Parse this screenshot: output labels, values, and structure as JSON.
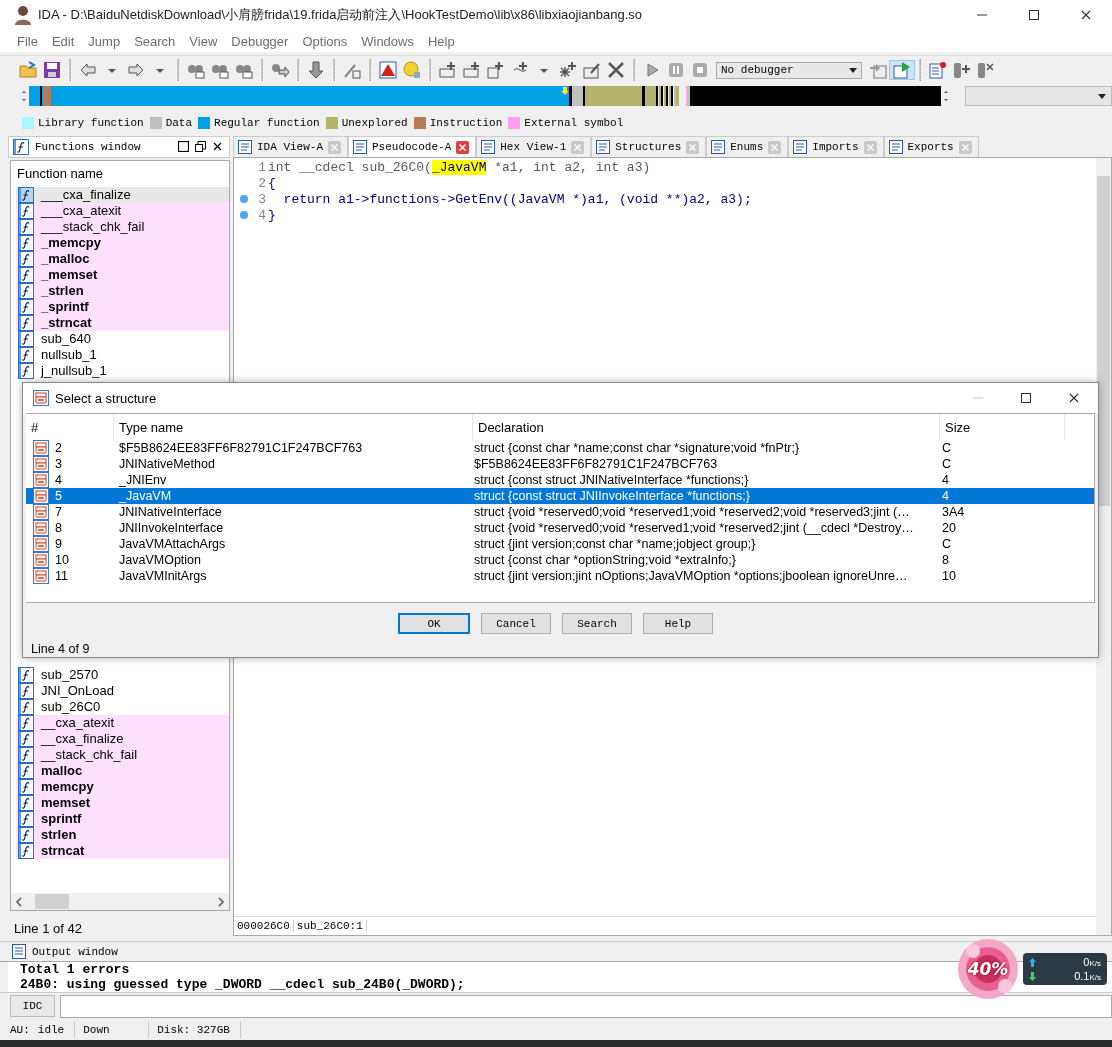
{
  "window": {
    "title": "IDA - D:\\BaiduNetdiskDownload\\小肩膀frida\\19.frida启动前注入\\HookTestDemo\\lib\\x86\\libxiaojianbang.so"
  },
  "menu": [
    "File",
    "Edit",
    "Jump",
    "Search",
    "View",
    "Debugger",
    "Options",
    "Windows",
    "Help"
  ],
  "debugger_select": {
    "value": "No debugger"
  },
  "legend": [
    {
      "label": "Library function",
      "color": "#aaf8ff"
    },
    {
      "label": "Data",
      "color": "#c0c0c0"
    },
    {
      "label": "Regular function",
      "color": "#00a0e6"
    },
    {
      "label": "Unexplored",
      "color": "#b4b46c"
    },
    {
      "label": "Instruction",
      "color": "#b87a58"
    },
    {
      "label": "External symbol",
      "color": "#ff9ff0"
    }
  ],
  "functions_window": {
    "title": "Functions window",
    "column": "Function name",
    "row_groups": [
      [
        {
          "name": "___cxa_finalize",
          "kind": "regular",
          "bold": false,
          "selected": true
        },
        {
          "name": "___cxa_atexit",
          "kind": "external",
          "bold": false,
          "selected": false
        },
        {
          "name": "___stack_chk_fail",
          "kind": "external",
          "bold": false,
          "selected": false
        },
        {
          "name": "_memcpy",
          "kind": "external",
          "bold": true,
          "selected": false
        },
        {
          "name": "_malloc",
          "kind": "external",
          "bold": true,
          "selected": false
        },
        {
          "name": "_memset",
          "kind": "external",
          "bold": true,
          "selected": false
        },
        {
          "name": "_strlen",
          "kind": "external",
          "bold": true,
          "selected": false
        },
        {
          "name": "_sprintf",
          "kind": "external",
          "bold": true,
          "selected": false
        },
        {
          "name": "_strncat",
          "kind": "external",
          "bold": true,
          "selected": false
        },
        {
          "name": "sub_640",
          "kind": "regular",
          "bold": false,
          "selected": false
        },
        {
          "name": "nullsub_1",
          "kind": "regular",
          "bold": false,
          "selected": false
        },
        {
          "name": "j_nullsub_1",
          "kind": "regular",
          "bold": false,
          "selected": false
        }
      ],
      [
        {
          "name": "sub_2570",
          "kind": "regular",
          "bold": false,
          "selected": false
        },
        {
          "name": "JNI_OnLoad",
          "kind": "regular",
          "bold": false,
          "selected": false
        },
        {
          "name": "sub_26C0",
          "kind": "regular",
          "bold": false,
          "selected": false
        },
        {
          "name": "__cxa_atexit",
          "kind": "external",
          "bold": false,
          "selected": false
        },
        {
          "name": "__cxa_finalize",
          "kind": "external",
          "bold": false,
          "selected": false
        },
        {
          "name": "__stack_chk_fail",
          "kind": "external",
          "bold": false,
          "selected": false
        },
        {
          "name": "malloc",
          "kind": "external",
          "bold": true,
          "selected": false
        },
        {
          "name": "memcpy",
          "kind": "external",
          "bold": true,
          "selected": false
        },
        {
          "name": "memset",
          "kind": "external",
          "bold": true,
          "selected": false
        },
        {
          "name": "sprintf",
          "kind": "external",
          "bold": true,
          "selected": false
        },
        {
          "name": "strlen",
          "kind": "external",
          "bold": true,
          "selected": false
        },
        {
          "name": "strncat",
          "kind": "external",
          "bold": true,
          "selected": false
        }
      ]
    ],
    "status": "Line 1 of 42"
  },
  "tabs": [
    {
      "label": "IDA View-A",
      "selected": false
    },
    {
      "label": "Pseudocode-A",
      "selected": true
    },
    {
      "label": "Hex View-1",
      "selected": false
    },
    {
      "label": "Structures",
      "selected": false
    },
    {
      "label": "Enums",
      "selected": false
    },
    {
      "label": "Imports",
      "selected": false
    },
    {
      "label": "Exports",
      "selected": false
    }
  ],
  "code": {
    "lines": [
      {
        "number": "1",
        "marked": false,
        "segments": [
          {
            "text": "int __cdecl sub_26C0(",
            "kind": "decl"
          },
          {
            "text": "_JavaVM",
            "kind": "highlight"
          },
          {
            "text": " *a1, int a2, int a3)",
            "kind": "decl"
          }
        ]
      },
      {
        "number": "2",
        "marked": false,
        "segments": [
          {
            "text": "{",
            "kind": "plain"
          }
        ]
      },
      {
        "number": "3",
        "marked": true,
        "segments": [
          {
            "text": "  return a1->functions->GetEnv((JavaVM *)a1, (void **)a2, a3);",
            "kind": "plain"
          }
        ]
      },
      {
        "number": "4",
        "marked": true,
        "segments": [
          {
            "text": "}",
            "kind": "plain"
          }
        ]
      }
    ],
    "status": [
      "000026C0",
      "sub_26C0:1"
    ]
  },
  "dialog": {
    "title": "Select a structure",
    "columns": [
      "#",
      "Type name",
      "Declaration",
      "Size"
    ],
    "rows": [
      {
        "number": "2",
        "name": "$F5B8624EE83FF6F82791C1F247BCF763",
        "declaration": "struct {const char *name;const char *signature;void *fnPtr;}",
        "size": "C",
        "selected": false
      },
      {
        "number": "3",
        "name": "JNINativeMethod",
        "declaration": "$F5B8624EE83FF6F82791C1F247BCF763",
        "size": "C",
        "selected": false
      },
      {
        "number": "4",
        "name": "_JNIEnv",
        "declaration": "struct {const struct JNINativeInterface *functions;}",
        "size": "4",
        "selected": false
      },
      {
        "number": "5",
        "name": "_JavaVM",
        "declaration": "struct {const struct JNIInvokeInterface *functions;}",
        "size": "4",
        "selected": true
      },
      {
        "number": "7",
        "name": "JNINativeInterface",
        "declaration": "struct {void *reserved0;void *reserved1;void *reserved2;void *reserved3;jint (…",
        "size": "3A4",
        "selected": false
      },
      {
        "number": "8",
        "name": "JNIInvokeInterface",
        "declaration": "struct {void *reserved0;void *reserved1;void *reserved2;jint (__cdecl *Destroy…",
        "size": "20",
        "selected": false
      },
      {
        "number": "9",
        "name": "JavaVMAttachArgs",
        "declaration": "struct {jint version;const char *name;jobject group;}",
        "size": "C",
        "selected": false
      },
      {
        "number": "10",
        "name": "JavaVMOption",
        "declaration": "struct {const char *optionString;void *extraInfo;}",
        "size": "8",
        "selected": false
      },
      {
        "number": "11",
        "name": "JavaVMInitArgs",
        "declaration": "struct {jint version;jint nOptions;JavaVMOption *options;jboolean ignoreUnre…",
        "size": "10",
        "selected": false
      }
    ],
    "buttons": [
      {
        "label": "OK",
        "default": true
      },
      {
        "label": "Cancel",
        "default": false
      },
      {
        "label": "Search",
        "default": false
      },
      {
        "label": "Help",
        "default": false
      }
    ],
    "status": "Line 4 of 9"
  },
  "output": {
    "title": "Output window",
    "lines": [
      "Total 1 errors",
      "24B0: using guessed type _DWORD __cdecl sub_24B0(_DWORD);"
    ],
    "command_button": "IDC"
  },
  "status_bar": [
    "AU:",
    "idle",
    "Down",
    "Disk: 327GB"
  ],
  "network_widget": {
    "percent": "40%",
    "upload": "0",
    "upload_unit": "K/s",
    "download": "0.1",
    "download_unit": "K/s"
  }
}
